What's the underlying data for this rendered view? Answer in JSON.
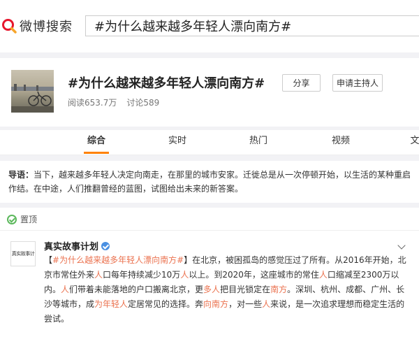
{
  "header": {
    "logo_text": "微博搜索",
    "search_value": "#为什么越来越多年轻人漂向南方#"
  },
  "topic": {
    "title": "#为什么越来越多年轻人漂向南方#",
    "reads": "阅读653.7万",
    "discussions": "讨论589",
    "share_label": "分享",
    "host_label": "申请主持人"
  },
  "tabs": [
    "综合",
    "实时",
    "热门",
    "视频",
    "文"
  ],
  "guide": {
    "label": "导语：",
    "text": "当下，越来越多年轻人决定向南走，在那里的城市安家。迁徙总是从一次停顿开始，以生活的某种重启作结。在中途，人们推翻曾经的蓝图，试图给出未来的新答案。"
  },
  "post": {
    "pin_label": "置顶",
    "avatar_text": "真实故事计",
    "author": "真实故事计划",
    "text_segments": [
      {
        "text": "【",
        "hl": false
      },
      {
        "text": "#为什么越来越多年轻人漂向南方#",
        "hl": true
      },
      {
        "text": "】在北京，被困孤岛的感觉压过了所有。从2016年开始，北京市常住外来",
        "hl": false
      },
      {
        "text": "人",
        "hl": true
      },
      {
        "text": "口每年持续减少10万",
        "hl": false
      },
      {
        "text": "人",
        "hl": true
      },
      {
        "text": "以上。到2020年，这座城市的常住",
        "hl": false
      },
      {
        "text": "人",
        "hl": true
      },
      {
        "text": "口缩减至2300万以内。",
        "hl": false
      },
      {
        "text": "人",
        "hl": true
      },
      {
        "text": "们带着未能落地的户口搬离北京，更",
        "hl": false
      },
      {
        "text": "多人",
        "hl": true
      },
      {
        "text": "把目光锁定在",
        "hl": false
      },
      {
        "text": "南方",
        "hl": true
      },
      {
        "text": "。深圳、杭州、成都、广州、长沙等城市，成",
        "hl": false
      },
      {
        "text": "为年轻人",
        "hl": true
      },
      {
        "text": "定居常见的选择。奔",
        "hl": false
      },
      {
        "text": "向南方",
        "hl": true
      },
      {
        "text": "，对一些",
        "hl": false
      },
      {
        "text": "人",
        "hl": true
      },
      {
        "text": "来说，是一次追求理想而稳定生活的尝试。",
        "hl": false
      }
    ]
  },
  "colors": {
    "accent": "#ff8200",
    "highlight": "#eb7350",
    "verified": "#4a90e2",
    "search_icon": "#e6162d"
  }
}
